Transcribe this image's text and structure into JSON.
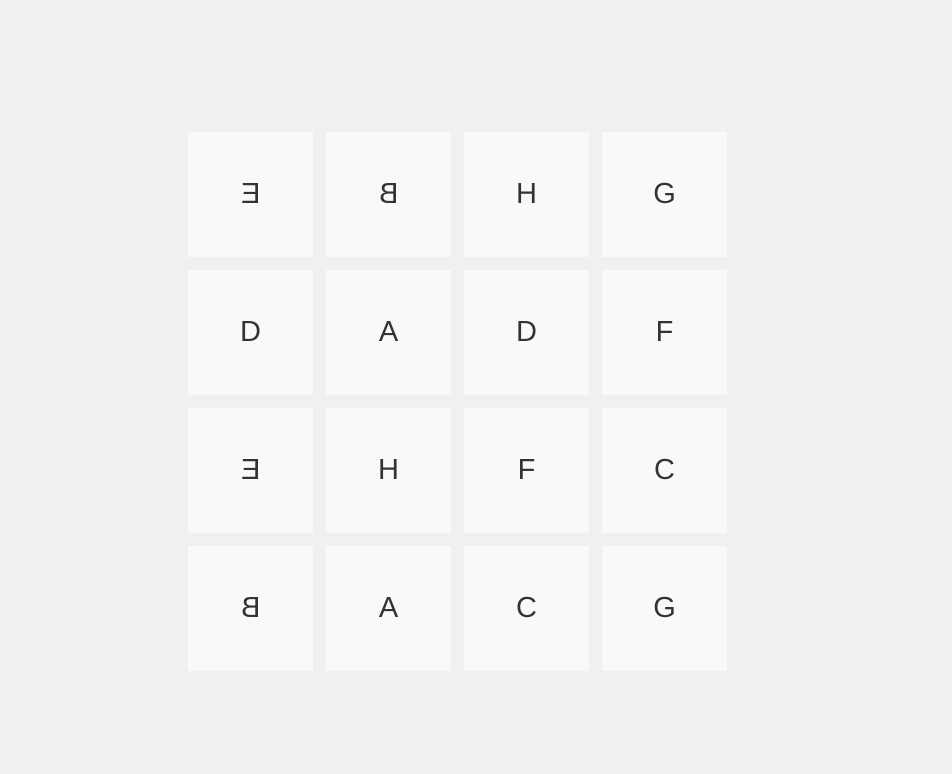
{
  "board": {
    "cards": [
      {
        "letter": "E",
        "mirrored": true
      },
      {
        "letter": "B",
        "mirrored": true
      },
      {
        "letter": "H",
        "mirrored": false
      },
      {
        "letter": "G",
        "mirrored": false
      },
      {
        "letter": "D",
        "mirrored": false
      },
      {
        "letter": "A",
        "mirrored": false
      },
      {
        "letter": "D",
        "mirrored": false
      },
      {
        "letter": "F",
        "mirrored": false
      },
      {
        "letter": "E",
        "mirrored": true
      },
      {
        "letter": "H",
        "mirrored": false
      },
      {
        "letter": "F",
        "mirrored": false
      },
      {
        "letter": "C",
        "mirrored": false
      },
      {
        "letter": "B",
        "mirrored": true
      },
      {
        "letter": "A",
        "mirrored": false
      },
      {
        "letter": "C",
        "mirrored": false
      },
      {
        "letter": "G",
        "mirrored": false
      }
    ]
  },
  "colors": {
    "background": "#f0f0f0",
    "card": "#f9f9f9",
    "text": "#333333"
  }
}
